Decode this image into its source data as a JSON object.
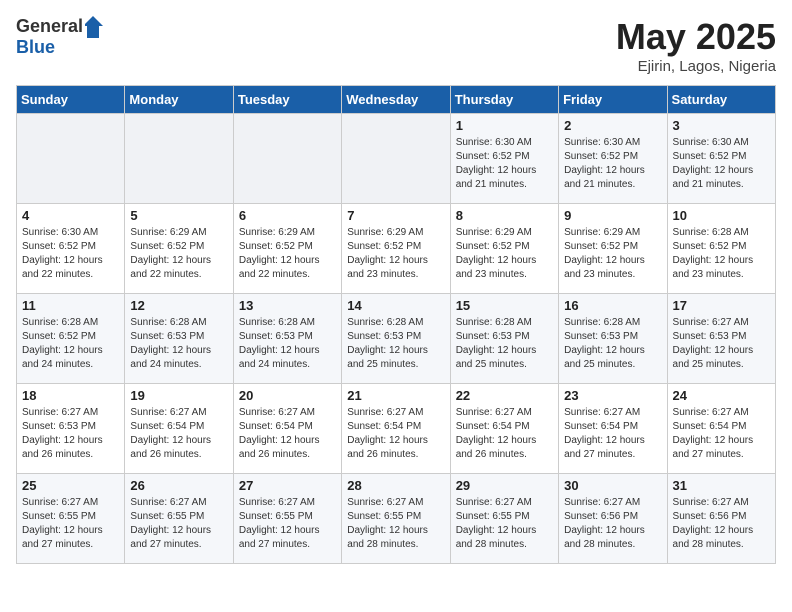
{
  "header": {
    "logo_general": "General",
    "logo_blue": "Blue",
    "title": "May 2025",
    "location": "Ejirin, Lagos, Nigeria"
  },
  "weekdays": [
    "Sunday",
    "Monday",
    "Tuesday",
    "Wednesday",
    "Thursday",
    "Friday",
    "Saturday"
  ],
  "weeks": [
    [
      {
        "day": "",
        "info": ""
      },
      {
        "day": "",
        "info": ""
      },
      {
        "day": "",
        "info": ""
      },
      {
        "day": "",
        "info": ""
      },
      {
        "day": "1",
        "info": "Sunrise: 6:30 AM\nSunset: 6:52 PM\nDaylight: 12 hours\nand 21 minutes."
      },
      {
        "day": "2",
        "info": "Sunrise: 6:30 AM\nSunset: 6:52 PM\nDaylight: 12 hours\nand 21 minutes."
      },
      {
        "day": "3",
        "info": "Sunrise: 6:30 AM\nSunset: 6:52 PM\nDaylight: 12 hours\nand 21 minutes."
      }
    ],
    [
      {
        "day": "4",
        "info": "Sunrise: 6:30 AM\nSunset: 6:52 PM\nDaylight: 12 hours\nand 22 minutes."
      },
      {
        "day": "5",
        "info": "Sunrise: 6:29 AM\nSunset: 6:52 PM\nDaylight: 12 hours\nand 22 minutes."
      },
      {
        "day": "6",
        "info": "Sunrise: 6:29 AM\nSunset: 6:52 PM\nDaylight: 12 hours\nand 22 minutes."
      },
      {
        "day": "7",
        "info": "Sunrise: 6:29 AM\nSunset: 6:52 PM\nDaylight: 12 hours\nand 23 minutes."
      },
      {
        "day": "8",
        "info": "Sunrise: 6:29 AM\nSunset: 6:52 PM\nDaylight: 12 hours\nand 23 minutes."
      },
      {
        "day": "9",
        "info": "Sunrise: 6:29 AM\nSunset: 6:52 PM\nDaylight: 12 hours\nand 23 minutes."
      },
      {
        "day": "10",
        "info": "Sunrise: 6:28 AM\nSunset: 6:52 PM\nDaylight: 12 hours\nand 23 minutes."
      }
    ],
    [
      {
        "day": "11",
        "info": "Sunrise: 6:28 AM\nSunset: 6:52 PM\nDaylight: 12 hours\nand 24 minutes."
      },
      {
        "day": "12",
        "info": "Sunrise: 6:28 AM\nSunset: 6:53 PM\nDaylight: 12 hours\nand 24 minutes."
      },
      {
        "day": "13",
        "info": "Sunrise: 6:28 AM\nSunset: 6:53 PM\nDaylight: 12 hours\nand 24 minutes."
      },
      {
        "day": "14",
        "info": "Sunrise: 6:28 AM\nSunset: 6:53 PM\nDaylight: 12 hours\nand 25 minutes."
      },
      {
        "day": "15",
        "info": "Sunrise: 6:28 AM\nSunset: 6:53 PM\nDaylight: 12 hours\nand 25 minutes."
      },
      {
        "day": "16",
        "info": "Sunrise: 6:28 AM\nSunset: 6:53 PM\nDaylight: 12 hours\nand 25 minutes."
      },
      {
        "day": "17",
        "info": "Sunrise: 6:27 AM\nSunset: 6:53 PM\nDaylight: 12 hours\nand 25 minutes."
      }
    ],
    [
      {
        "day": "18",
        "info": "Sunrise: 6:27 AM\nSunset: 6:53 PM\nDaylight: 12 hours\nand 26 minutes."
      },
      {
        "day": "19",
        "info": "Sunrise: 6:27 AM\nSunset: 6:54 PM\nDaylight: 12 hours\nand 26 minutes."
      },
      {
        "day": "20",
        "info": "Sunrise: 6:27 AM\nSunset: 6:54 PM\nDaylight: 12 hours\nand 26 minutes."
      },
      {
        "day": "21",
        "info": "Sunrise: 6:27 AM\nSunset: 6:54 PM\nDaylight: 12 hours\nand 26 minutes."
      },
      {
        "day": "22",
        "info": "Sunrise: 6:27 AM\nSunset: 6:54 PM\nDaylight: 12 hours\nand 26 minutes."
      },
      {
        "day": "23",
        "info": "Sunrise: 6:27 AM\nSunset: 6:54 PM\nDaylight: 12 hours\nand 27 minutes."
      },
      {
        "day": "24",
        "info": "Sunrise: 6:27 AM\nSunset: 6:54 PM\nDaylight: 12 hours\nand 27 minutes."
      }
    ],
    [
      {
        "day": "25",
        "info": "Sunrise: 6:27 AM\nSunset: 6:55 PM\nDaylight: 12 hours\nand 27 minutes."
      },
      {
        "day": "26",
        "info": "Sunrise: 6:27 AM\nSunset: 6:55 PM\nDaylight: 12 hours\nand 27 minutes."
      },
      {
        "day": "27",
        "info": "Sunrise: 6:27 AM\nSunset: 6:55 PM\nDaylight: 12 hours\nand 27 minutes."
      },
      {
        "day": "28",
        "info": "Sunrise: 6:27 AM\nSunset: 6:55 PM\nDaylight: 12 hours\nand 28 minutes."
      },
      {
        "day": "29",
        "info": "Sunrise: 6:27 AM\nSunset: 6:55 PM\nDaylight: 12 hours\nand 28 minutes."
      },
      {
        "day": "30",
        "info": "Sunrise: 6:27 AM\nSunset: 6:56 PM\nDaylight: 12 hours\nand 28 minutes."
      },
      {
        "day": "31",
        "info": "Sunrise: 6:27 AM\nSunset: 6:56 PM\nDaylight: 12 hours\nand 28 minutes."
      }
    ]
  ]
}
